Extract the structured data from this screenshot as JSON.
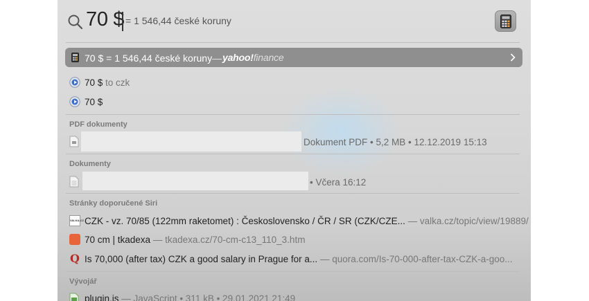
{
  "search": {
    "query": "70 $",
    "inline_result": "= 1 546,44 české koruny"
  },
  "top_hit": {
    "label": "70 $ = 1 546,44 české koruny",
    "separator": "—",
    "brand_main": "yahoo!",
    "brand_sub": "finance"
  },
  "suggestions": [
    {
      "main": "70 $",
      "extra": "to czk"
    },
    {
      "main": "70 $",
      "extra": ""
    }
  ],
  "sections": {
    "pdf": {
      "title": "PDF dokumenty",
      "meta": "Dokument PDF • 5,2 MB • 12.12.2019 15:13"
    },
    "docs": {
      "title": "Dokumenty",
      "meta": "• Včera 16:12"
    },
    "siri": {
      "title": "Stránky doporučené Siri",
      "items": [
        {
          "title": "CZK - vz. 70/85 (122mm raketomet) : Československo / ČR / SR (CZK/CZE...",
          "url": "— valka.cz/topic/view/19889/",
          "icon_label": "VALKA.CZ"
        },
        {
          "title": "70 cm | tkadexa",
          "url": "— tkadexa.cz/70-cm-c13_110_3.htm"
        },
        {
          "title": "Is 70,000 (after tax) CZK a good salary in Prague for a...",
          "url": "— quora.com/Is-70-000-after-tax-CZK-a-goo..."
        }
      ]
    },
    "dev": {
      "title": "Vývojář",
      "item_name": "plugin.js",
      "item_meta": "— JavaScript • 311 kB • 29.01.2021 21:49"
    }
  },
  "colors": {
    "top_hit_bg": "#8f8f8f",
    "accent_quora": "#b92b27",
    "accent_tkadexa": "#e8643a"
  }
}
